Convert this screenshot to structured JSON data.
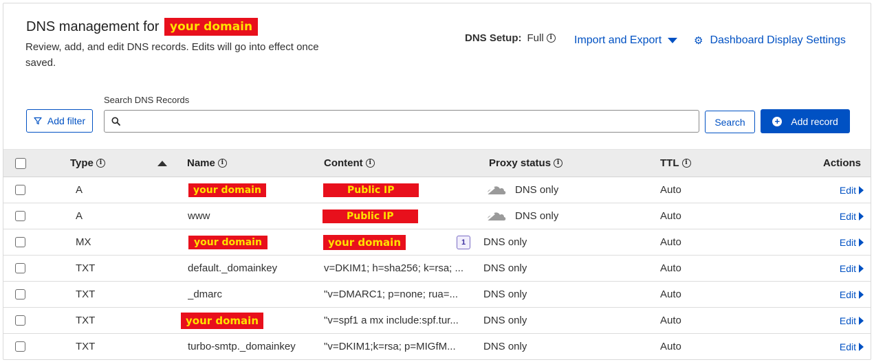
{
  "header": {
    "title_prefix": "DNS management for",
    "title_domain": "your domain",
    "subtitle": "Review, add, and edit DNS records. Edits will go into effect once saved."
  },
  "dns_setup": {
    "label": "DNS Setup:",
    "value": "Full"
  },
  "actions": {
    "import_export": "Import and Export",
    "dashboard_settings": "Dashboard Display Settings",
    "add_filter": "Add filter",
    "search_label": "Search DNS Records",
    "search_value": "",
    "search_button": "Search",
    "add_record": "Add record"
  },
  "table": {
    "headers": {
      "type": "Type",
      "name": "Name",
      "content": "Content",
      "proxy": "Proxy status",
      "ttl": "TTL",
      "actions": "Actions"
    },
    "edit_label": "Edit",
    "rows": [
      {
        "type": "A",
        "name": "your domain",
        "content": "Public IP",
        "proxy": "DNS only",
        "ttl": "Auto"
      },
      {
        "type": "A",
        "name": "www",
        "content": "Public IP",
        "proxy": "DNS only",
        "ttl": "Auto"
      },
      {
        "type": "MX",
        "name": "your domain",
        "content": "your domain",
        "priority": "1",
        "proxy": "DNS only",
        "ttl": "Auto"
      },
      {
        "type": "TXT",
        "name": "default._domainkey",
        "content": "v=DKIM1; h=sha256; k=rsa; ...",
        "proxy": "DNS only",
        "ttl": "Auto"
      },
      {
        "type": "TXT",
        "name": "_dmarc",
        "content": "\"v=DMARC1; p=none; rua=...",
        "proxy": "DNS only",
        "ttl": "Auto"
      },
      {
        "type": "TXT",
        "name": "your domain",
        "content": "\"v=spf1 a mx include:spf.tur...",
        "proxy": "DNS only",
        "ttl": "Auto"
      },
      {
        "type": "TXT",
        "name": "turbo-smtp._domainkey",
        "content": "\"v=DKIM1;k=rsa; p=MIGfM...",
        "proxy": "DNS only",
        "ttl": "Auto"
      }
    ]
  },
  "colors": {
    "link": "#0051c3",
    "redaction_bg": "#e8101c",
    "redaction_text": "#ffe200"
  },
  "icons": [
    "info-icon",
    "caret-down-icon",
    "gear-icon",
    "filter-icon",
    "search-icon",
    "plus-circle-icon",
    "sort-asc-icon",
    "cloud-off-icon",
    "play-icon"
  ]
}
